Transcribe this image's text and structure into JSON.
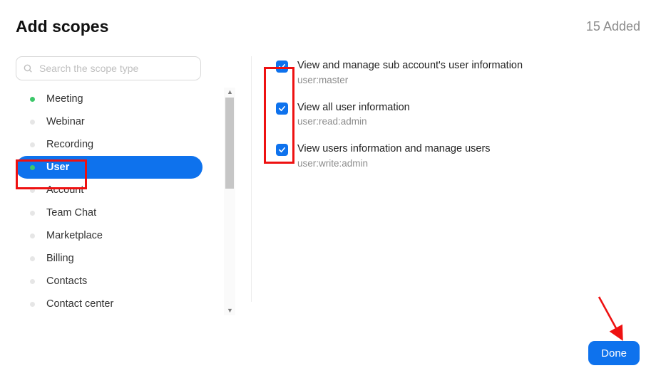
{
  "header": {
    "title": "Add scopes",
    "added_text": "15 Added"
  },
  "search": {
    "placeholder": "Search the scope type"
  },
  "sidebar": {
    "items": [
      {
        "label": "Meeting",
        "has_dot_green": true,
        "active": false
      },
      {
        "label": "Webinar",
        "has_dot_green": false,
        "active": false
      },
      {
        "label": "Recording",
        "has_dot_green": false,
        "active": false
      },
      {
        "label": "User",
        "has_dot_green": true,
        "active": true
      },
      {
        "label": "Account",
        "has_dot_green": false,
        "active": false
      },
      {
        "label": "Team Chat",
        "has_dot_green": false,
        "active": false
      },
      {
        "label": "Marketplace",
        "has_dot_green": false,
        "active": false
      },
      {
        "label": "Billing",
        "has_dot_green": false,
        "active": false
      },
      {
        "label": "Contacts",
        "has_dot_green": false,
        "active": false
      },
      {
        "label": "Contact center",
        "has_dot_green": false,
        "active": false
      }
    ]
  },
  "scopes": [
    {
      "title": "View and manage sub account's user information",
      "identifier": "user:master",
      "checked": true
    },
    {
      "title": "View all user information",
      "identifier": "user:read:admin",
      "checked": true
    },
    {
      "title": "View users information and manage users",
      "identifier": "user:write:admin",
      "checked": true
    }
  ],
  "buttons": {
    "done": "Done"
  }
}
